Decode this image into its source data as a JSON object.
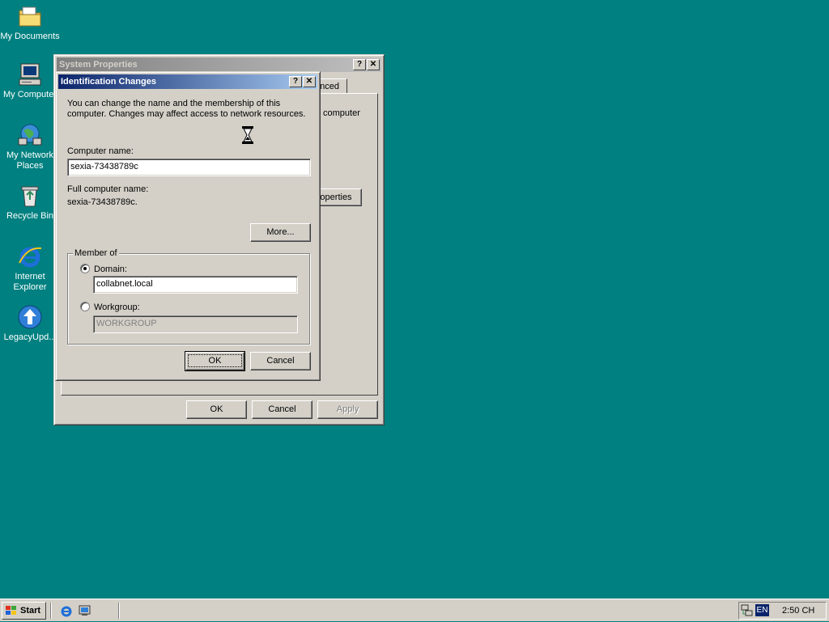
{
  "desktop": {
    "icons": [
      {
        "label": "My Documents"
      },
      {
        "label": "My Computer"
      },
      {
        "label": "My Network Places"
      },
      {
        "label": "Recycle Bin"
      },
      {
        "label": "Internet Explorer"
      },
      {
        "label": "LegacyUpd..."
      }
    ]
  },
  "system_properties": {
    "title": "System Properties",
    "tab_partial": "anced",
    "text_partial": "computer",
    "properties_button_partial": "operties",
    "ok": "OK",
    "cancel": "Cancel",
    "apply": "Apply"
  },
  "identification_changes": {
    "title": "Identification Changes",
    "description_line1": "You can change the name and the membership of this",
    "description_line2": "computer. Changes may affect access to network resources.",
    "computer_name_label": "Computer name:",
    "computer_name_value": "sexia-73438789c",
    "full_name_label": "Full computer name:",
    "full_name_value": "sexia-73438789c.",
    "more_button": "More...",
    "member_of_label": "Member of",
    "domain_label": "Domain:",
    "domain_value": "collabnet.local",
    "domain_selected": true,
    "workgroup_label": "Workgroup:",
    "workgroup_value": "WORKGROUP",
    "ok": "OK",
    "cancel": "Cancel"
  },
  "taskbar": {
    "start_label": "Start",
    "language": "EN",
    "clock": "2:50 CH"
  }
}
